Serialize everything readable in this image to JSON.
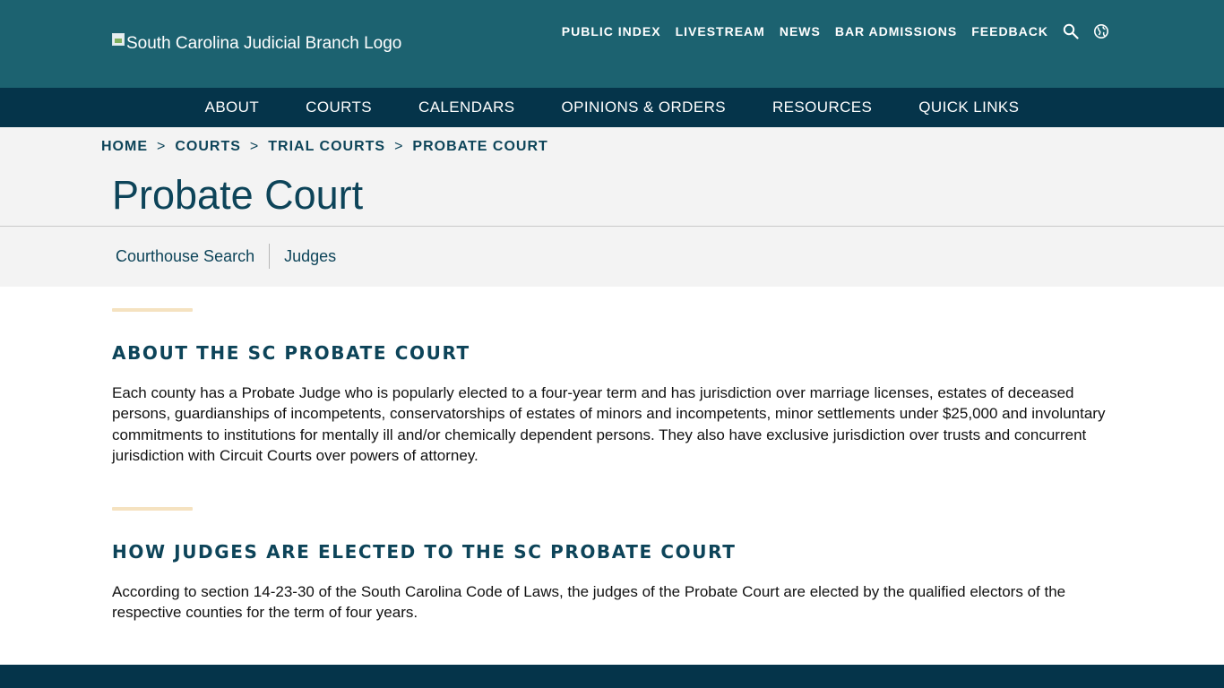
{
  "header": {
    "logo_alt": "South Carolina Judicial Branch Logo",
    "utility_links": [
      "PUBLIC INDEX",
      "LIVESTREAM",
      "NEWS",
      "BAR ADMISSIONS",
      "FEEDBACK"
    ],
    "search_icon": "search-icon",
    "language_icon": "globe-icon"
  },
  "main_nav": [
    "ABOUT",
    "COURTS",
    "CALENDARS",
    "OPINIONS & ORDERS",
    "RESOURCES",
    "QUICK LINKS"
  ],
  "breadcrumb": {
    "items": [
      "HOME",
      "COURTS",
      "TRIAL COURTS",
      "PROBATE COURT"
    ],
    "separator": ">"
  },
  "page_title": "Probate Court",
  "sub_nav": [
    "Courthouse Search",
    "Judges"
  ],
  "sections": [
    {
      "heading": "ABOUT THE SC PROBATE COURT",
      "body": "Each county has a Probate Judge who is popularly elected to a four-year term and has jurisdiction over marriage licenses, estates of deceased persons, guardianships of incompetents, conservatorships of estates of minors and incompetents, minor settlements under $25,000 and involuntary commitments to institutions for mentally ill and/or chemically dependent persons. They also have exclusive jurisdiction over trusts and concurrent jurisdiction with Circuit Courts over powers of attorney."
    },
    {
      "heading": "HOW JUDGES ARE ELECTED TO THE SC PROBATE COURT",
      "body": "According to section 14-23-30 of the South Carolina Code of Laws, the judges of the Probate Court are elected by the qualified electors of the respective counties for the term of four years."
    }
  ],
  "colors": {
    "header_bg": "#1c6270",
    "nav_bg": "#05344a",
    "title_color": "#0d4459",
    "light_bg": "#f3f3f3",
    "accent_bar": "#f5e2c0"
  }
}
